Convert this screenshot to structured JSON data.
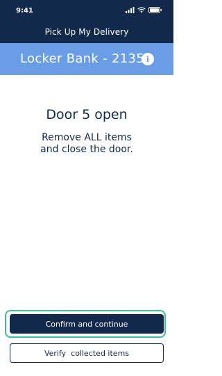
{
  "status_bar": {
    "time": "9:41",
    "icons": [
      "signal-icon",
      "wifi-icon",
      "battery-icon"
    ]
  },
  "header": {
    "title": "Pick Up My Delivery"
  },
  "locker": {
    "title": "Locker Bank - 2135",
    "info_glyph": "i"
  },
  "main": {
    "door_status": "Door 5 open",
    "instruction_line1": "Remove ALL items",
    "instruction_line2": "and close the door."
  },
  "actions": {
    "confirm_label": "Confirm and continue",
    "verify_label": "Verify  collected items"
  },
  "colors": {
    "navy": "#13294b",
    "banner_blue": "#6a9de6",
    "focus_green": "#3dbd9a",
    "white": "#ffffff"
  }
}
